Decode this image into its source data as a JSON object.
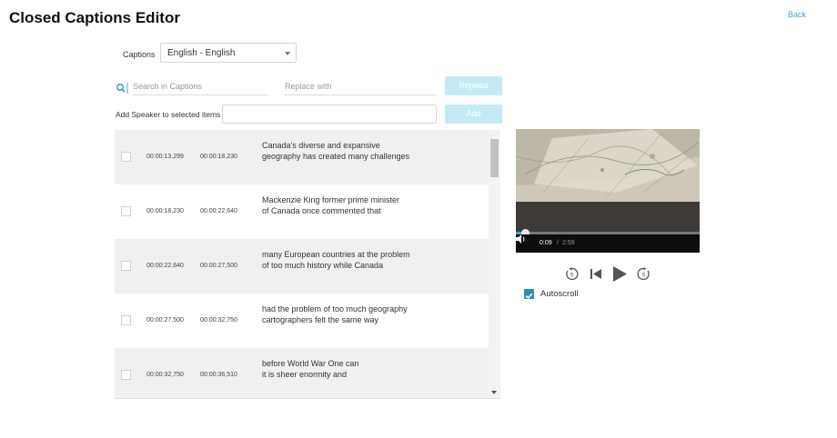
{
  "header": {
    "title": "Closed Captions Editor",
    "back_label": "Back"
  },
  "language": {
    "label": "Captions",
    "selected": "English - English"
  },
  "search": {
    "placeholder": "Search in Captions",
    "replace_placeholder": "Replace with",
    "replace_button": "Replace"
  },
  "speaker": {
    "label": "Add Speaker to selected items",
    "add_button": "Add"
  },
  "captions": [
    {
      "start": "00:00:13,299",
      "end": "00:00:18,230",
      "text": "Canada's diverse and expansive\ngeography has created many challenges"
    },
    {
      "start": "00:00:18,230",
      "end": "00:00:22,640",
      "text": "Mackenzie King former prime minister\nof Canada once commented that"
    },
    {
      "start": "00:00:22,640",
      "end": "00:00:27,500",
      "text": "many European countries at the problem\nof too much history while Canada"
    },
    {
      "start": "00:00:27,500",
      "end": "00:00:32,750",
      "text": "had the problem of too much geography\ncartographers felt the same way"
    },
    {
      "start": "00:00:32,750",
      "end": "00:00:36,510",
      "text": "before World War One can\nit is sheer enormity and"
    }
  ],
  "player": {
    "current_time": "0:09",
    "separator": "/",
    "total_time": "2:59",
    "progress": 0.05,
    "accent_color": "#3fa6c9"
  },
  "controls": {
    "icons": [
      "rewind-5-icon",
      "skip-back-icon",
      "play-icon",
      "forward-5-icon"
    ],
    "autoscroll_label": "Autoscroll",
    "autoscroll_checked": true
  },
  "colors": {
    "accent": "#3fa6c9",
    "button_disabled": "#c4ebf5",
    "row_shade": "#f0f0f0"
  }
}
